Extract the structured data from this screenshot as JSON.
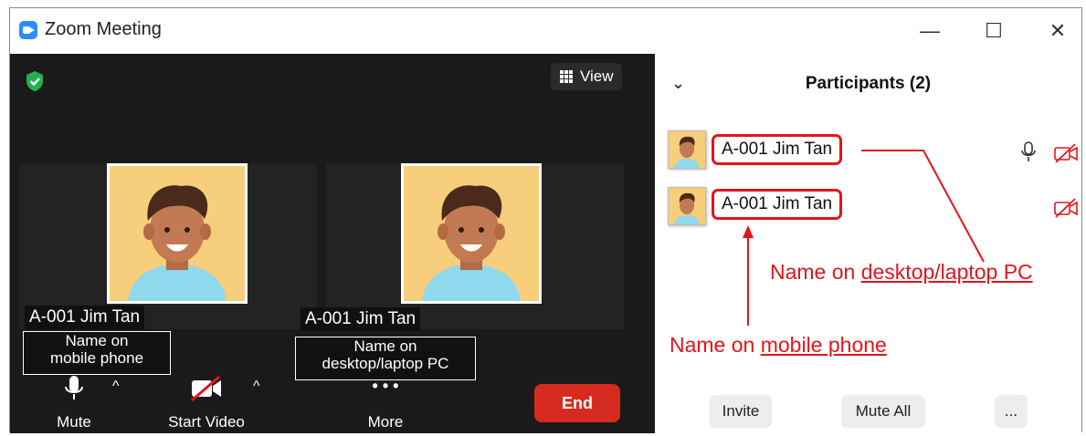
{
  "window": {
    "title": "Zoom Meeting",
    "controls": [
      "minimize",
      "maximize",
      "close"
    ]
  },
  "video": {
    "view_label": "View",
    "tiles": [
      {
        "name": "A-001 Jim Tan"
      },
      {
        "name": "A-001 Jim Tan"
      }
    ],
    "annotations": {
      "mobile": "Name on\nmobile phone",
      "desktop": "Name on\ndesktop/laptop PC"
    }
  },
  "toolbar": {
    "mute_label": "Mute",
    "video_label": "Start Video",
    "more_label": "More",
    "end_label": "End"
  },
  "participants": {
    "title": "Participants (2)",
    "list": [
      {
        "name": "A-001 Jim Tan",
        "mic": true,
        "video_off": true
      },
      {
        "name": "A-001 Jim Tan",
        "mic": false,
        "video_off": true
      }
    ],
    "note_desktop_prefix": "Name on ",
    "note_desktop_link": "desktop/laptop PC",
    "note_mobile_prefix": "Name on ",
    "note_mobile_link": "mobile phone",
    "invite_label": "Invite",
    "mute_all_label": "Mute All",
    "more_label": "..."
  },
  "colors": {
    "accent": "#2d8cff",
    "end": "#d52b1e",
    "annotation": "#e3141b",
    "security": "#22b14c"
  }
}
